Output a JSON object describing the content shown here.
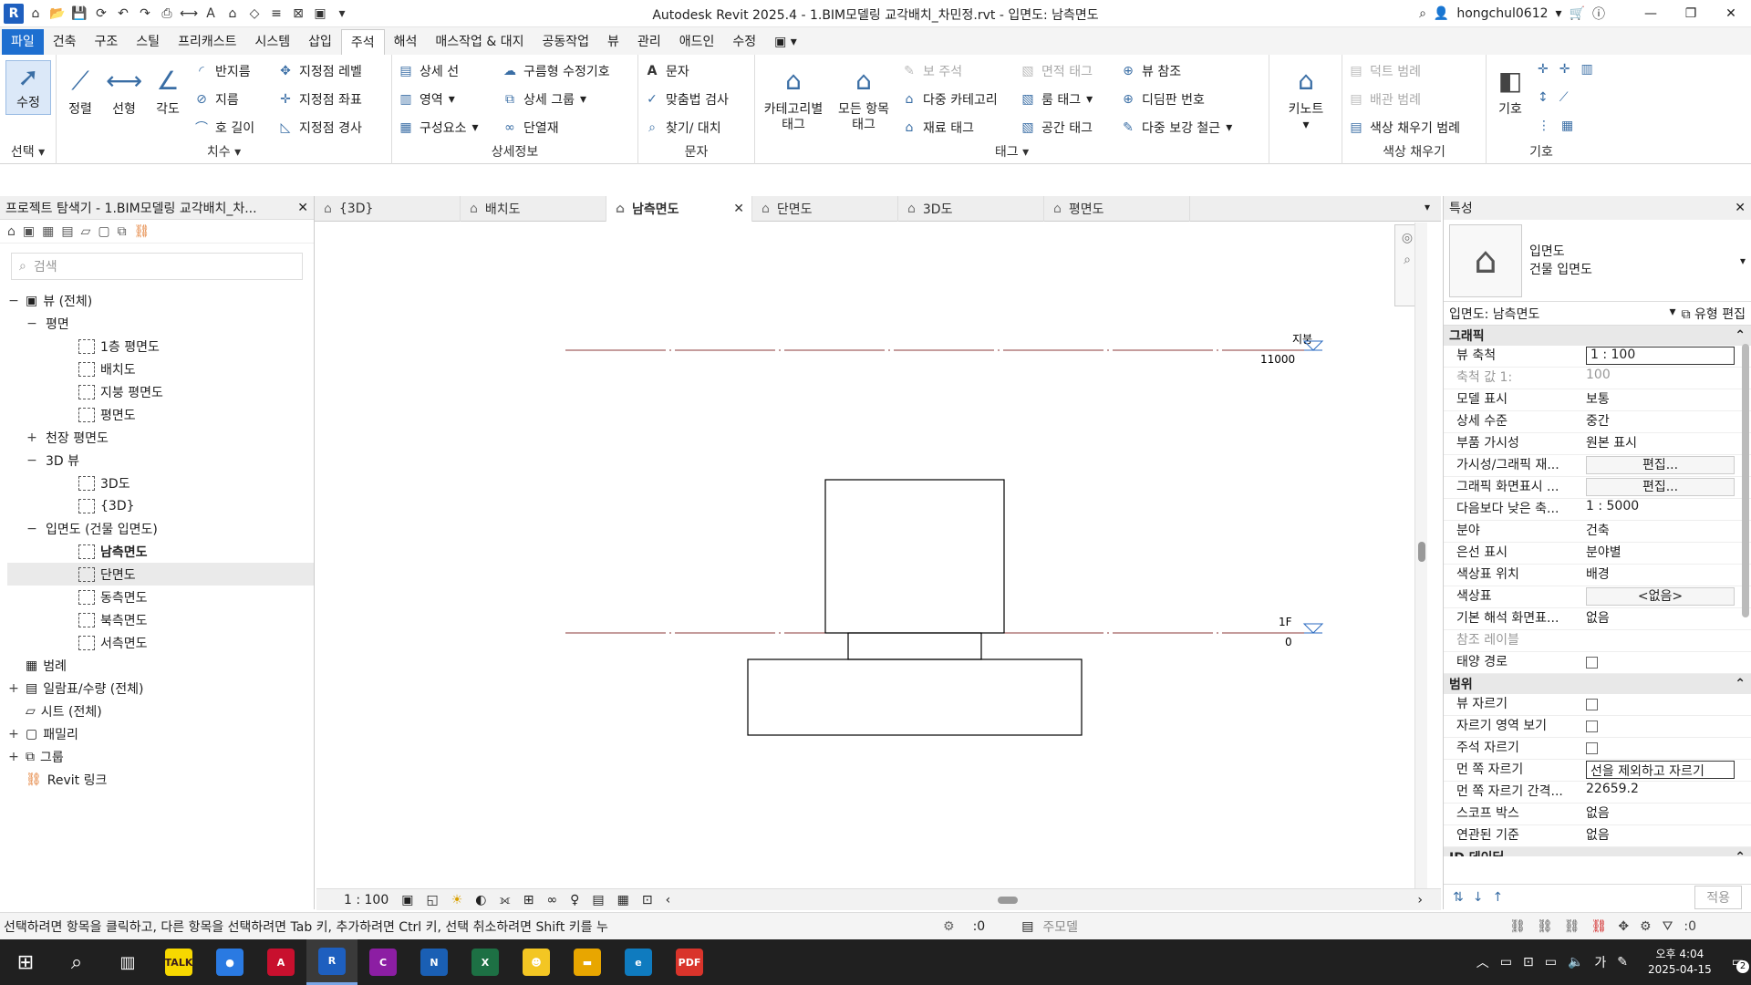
{
  "title_bar": {
    "title": "Autodesk Revit 2025.4 - 1.BIM모델링 교각배치_차민정.rvt - 입면도: 남측면도",
    "username": "hongchul0612"
  },
  "ribbon_tabs": [
    "파일",
    "건축",
    "구조",
    "스틸",
    "프리캐스트",
    "시스템",
    "삽입",
    "주석",
    "해석",
    "매스작업 & 대지",
    "공동작업",
    "뷰",
    "관리",
    "애드인",
    "수정"
  ],
  "ribbon": {
    "select_panel": {
      "modify": "수정",
      "title": "선택"
    },
    "dimension_panel": {
      "aligned": "정렬",
      "linear": "선형",
      "angular": "각도",
      "radius": "반지름",
      "diameter": "지름",
      "arc_length": "호 길이",
      "spot_elevation": "지정점 레벨",
      "spot_coordinate": "지정점 좌표",
      "spot_slope": "지정점 경사",
      "title": "치수"
    },
    "detail_panel": {
      "detail_line": "상세 선",
      "region": "영역",
      "component": "구성요소",
      "revision_cloud": "구름형 수정기호",
      "detail_group": "상세 그룹",
      "insulation": "단열재",
      "title": "상세정보"
    },
    "text_panel": {
      "text": "문자",
      "spell_check": "맞춤법 검사",
      "find_replace": "찾기/ 대치",
      "title": "문자"
    },
    "tag_panel": {
      "tag_by_category": "카테고리별 태그",
      "tag_all": "모든 항목 태그",
      "beam_annotation": "보 주석",
      "multi_category": "다중 카테고리",
      "material_tag": "재료 태그",
      "area_tag": "면적 태그",
      "room_tag": "룸 태그",
      "space_tag": "공간 태그",
      "view_reference": "뷰 참조",
      "tread_number": "디딤판 번호",
      "multi_rebar": "다중 보강 철근",
      "title": "태그"
    },
    "keynote": "키노트",
    "color_fill_panel": {
      "duct_legend": "덕트 범례",
      "pipe_legend": "배관 범례",
      "color_fill_legend": "색상 채우기 범례",
      "title": "색상 채우기"
    },
    "symbol_panel": {
      "symbol": "기호",
      "title": "기호"
    }
  },
  "project_browser": {
    "title": "프로젝트 탐색기 - 1.BIM모델링 교각배치_차...",
    "search_placeholder": "검색",
    "tree": [
      {
        "level": 0,
        "toggle": "−",
        "icon": "views",
        "label": "뷰 (전체)"
      },
      {
        "level": 1,
        "toggle": "−",
        "icon": "",
        "label": "평면"
      },
      {
        "level": 2,
        "toggle": "",
        "icon": "view",
        "label": "1층 평면도"
      },
      {
        "level": 2,
        "toggle": "",
        "icon": "view",
        "label": "배치도"
      },
      {
        "level": 2,
        "toggle": "",
        "icon": "view",
        "label": "지붕 평면도"
      },
      {
        "level": 2,
        "toggle": "",
        "icon": "view",
        "label": "평면도"
      },
      {
        "level": 1,
        "toggle": "+",
        "icon": "",
        "label": "천장 평면도"
      },
      {
        "level": 1,
        "toggle": "−",
        "icon": "",
        "label": "3D 뷰"
      },
      {
        "level": 2,
        "toggle": "",
        "icon": "view",
        "label": "3D도"
      },
      {
        "level": 2,
        "toggle": "",
        "icon": "view",
        "label": "{3D}"
      },
      {
        "level": 1,
        "toggle": "−",
        "icon": "",
        "label": "입면도 (건물 입면도)"
      },
      {
        "level": 2,
        "toggle": "",
        "icon": "view",
        "label": "남측면도",
        "bold": true
      },
      {
        "level": 2,
        "toggle": "",
        "icon": "view",
        "label": "단면도",
        "selected": true
      },
      {
        "level": 2,
        "toggle": "",
        "icon": "view",
        "label": "동측면도"
      },
      {
        "level": 2,
        "toggle": "",
        "icon": "view",
        "label": "북측면도"
      },
      {
        "level": 2,
        "toggle": "",
        "icon": "view",
        "label": "서측면도"
      },
      {
        "level": 0,
        "toggle": "",
        "icon": "legend",
        "label": "범례"
      },
      {
        "level": 0,
        "toggle": "+",
        "icon": "schedule",
        "label": "일람표/수량 (전체)"
      },
      {
        "level": 0,
        "toggle": "",
        "icon": "sheet",
        "label": "시트 (전체)"
      },
      {
        "level": 0,
        "toggle": "+",
        "icon": "family",
        "label": "패밀리"
      },
      {
        "level": 0,
        "toggle": "+",
        "icon": "group",
        "label": "그룹"
      },
      {
        "level": 0,
        "toggle": "",
        "icon": "link",
        "label": "Revit 링크"
      }
    ]
  },
  "view_tabs": [
    {
      "label": "{3D}",
      "active": false
    },
    {
      "label": "배치도",
      "active": false
    },
    {
      "label": "남측면도",
      "active": true
    },
    {
      "label": "단면도",
      "active": false
    },
    {
      "label": "3D도",
      "active": false
    },
    {
      "label": "평면도",
      "active": false
    }
  ],
  "canvas": {
    "levels": [
      {
        "name": "지붕",
        "elevation": "11000"
      },
      {
        "name": "1F",
        "elevation": "0"
      }
    ]
  },
  "view_control_bar": {
    "scale": "1 : 100"
  },
  "properties": {
    "title": "특성",
    "type_name": "입면도",
    "type_sub": "건물 입면도",
    "selector": "입면도: 남측면도",
    "edit_type": "유형 편집",
    "sections": [
      {
        "name": "그래픽",
        "rows": [
          {
            "k": "뷰 축척",
            "v": "1 : 100",
            "kind": "input"
          },
          {
            "k": "축척 값    1:",
            "v": "100",
            "kind": "gray"
          },
          {
            "k": "모델 표시",
            "v": "보통"
          },
          {
            "k": "상세 수준",
            "v": "중간"
          },
          {
            "k": "부품 가시성",
            "v": "원본 표시"
          },
          {
            "k": "가시성/그래픽 재...",
            "v": "편집...",
            "kind": "button"
          },
          {
            "k": "그래픽 화면표시 ...",
            "v": "편집...",
            "kind": "button"
          },
          {
            "k": "다음보다 낮은 축...",
            "v": "1 : 5000"
          },
          {
            "k": "분야",
            "v": "건축"
          },
          {
            "k": "은선 표시",
            "v": "분야별"
          },
          {
            "k": "색상표 위치",
            "v": "배경"
          },
          {
            "k": "색상표",
            "v": "<없음>",
            "kind": "button"
          },
          {
            "k": "기본 해석 화면표...",
            "v": "없음"
          },
          {
            "k": "참조 레이블",
            "v": "",
            "kind": "gray"
          },
          {
            "k": "태양 경로",
            "v": "",
            "kind": "check"
          }
        ]
      },
      {
        "name": "범위",
        "rows": [
          {
            "k": "뷰 자르기",
            "v": "",
            "kind": "check"
          },
          {
            "k": "자르기 영역 보기",
            "v": "",
            "kind": "check"
          },
          {
            "k": "주석 자르기",
            "v": "",
            "kind": "check"
          },
          {
            "k": "먼 쪽 자르기",
            "v": "선을 제외하고 자르기",
            "kind": "input"
          },
          {
            "k": "먼 쪽 자르기 간격...",
            "v": "22659.2"
          },
          {
            "k": "스코프 박스",
            "v": "없음"
          },
          {
            "k": "연관된 기준",
            "v": "없음"
          }
        ]
      },
      {
        "name": "ID 데이터",
        "rows": []
      }
    ],
    "apply": "적용"
  },
  "status_bar": {
    "hint": "선택하려면 항목을 클릭하고, 다른 항목을 선택하려면 Tab 키, 추가하려면 Ctrl 키, 선택 취소하려면 Shift 키를 누",
    "count": ":0",
    "model": "주모델",
    "filter_count": ":0"
  },
  "taskbar": {
    "apps": [
      {
        "name": "kakaotalk",
        "label": "TALK",
        "color": "#f7d800"
      },
      {
        "name": "chrome",
        "label": "●",
        "color": "#2a7ae2"
      },
      {
        "name": "autocad",
        "label": "A",
        "color": "#c8102e"
      },
      {
        "name": "revit",
        "label": "R",
        "color": "#1e5fbf"
      },
      {
        "name": "civil3d",
        "label": "C",
        "color": "#8c1ea3"
      },
      {
        "name": "navisworks",
        "label": "N",
        "color": "#1a5fb4"
      },
      {
        "name": "excel",
        "label": "X",
        "color": "#1d7044"
      },
      {
        "name": "chat",
        "label": "☻",
        "color": "#f3c623"
      },
      {
        "name": "explorer",
        "label": "▬",
        "color": "#e8a600"
      },
      {
        "name": "edge",
        "label": "e",
        "color": "#0f7bbf"
      },
      {
        "name": "pdf",
        "label": "PDF",
        "color": "#d9342b"
      }
    ],
    "ime": "가",
    "ampm_time": "오후 4:04",
    "date": "2025-04-15",
    "notif_count": "2"
  }
}
